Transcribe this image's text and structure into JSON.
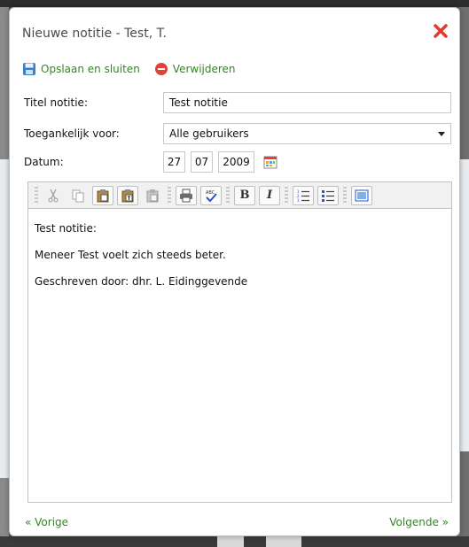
{
  "dialog": {
    "title": "Nieuwe notitie - Test, T.",
    "close_icon": "close-x-icon",
    "close_color": "#e23a2c"
  },
  "actions": {
    "save_label": "Opslaan en sluiten",
    "delete_label": "Verwijderen",
    "accent_color": "#2f8a1e"
  },
  "form": {
    "title_label": "Titel notitie:",
    "title_value": "Test notitie",
    "access_label": "Toegankelijk voor:",
    "access_value": "Alle gebruikers",
    "date_label": "Datum:",
    "date_day": "27",
    "date_month": "07",
    "date_year": "2009",
    "date_icon": "calendar-icon"
  },
  "toolbar": {
    "buttons": [
      "cut-icon",
      "copy-icon",
      "paste-icon",
      "paste-text-icon",
      "paste-word-icon",
      "print-icon",
      "spellcheck-icon",
      "bold-button",
      "italic-button",
      "ordered-list-icon",
      "unordered-list-icon",
      "source-icon"
    ],
    "bold_glyph": "B",
    "italic_glyph": "I"
  },
  "editor": {
    "lines": [
      "Test notitie:",
      "Meneer Test voelt zich steeds beter.",
      "Geschreven door: dhr. L. Eidinggevende"
    ]
  },
  "footer": {
    "prev_label": "« Vorige",
    "next_label": "Volgende »"
  }
}
